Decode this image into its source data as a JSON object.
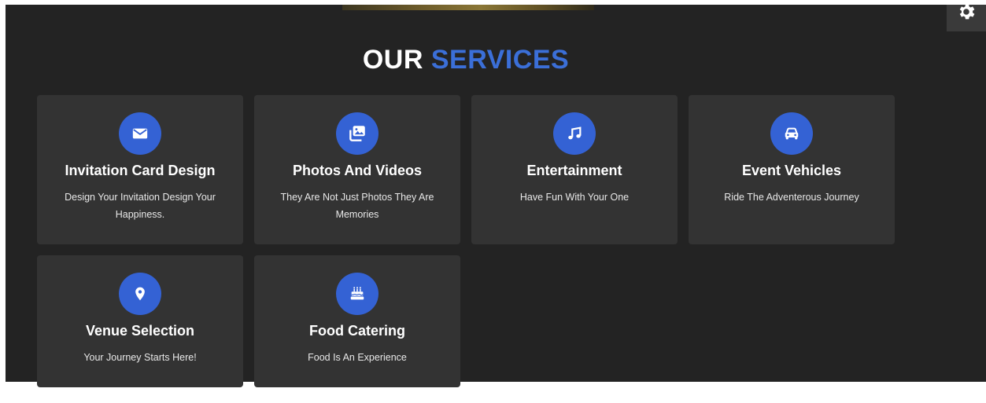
{
  "title": {
    "word1": "OUR",
    "word2": "SERVICES"
  },
  "colors": {
    "accent": "#3b6fd8",
    "icon_bg": "#3462d4",
    "card_bg": "#333333",
    "page_bg": "#232323"
  },
  "services": [
    {
      "icon": "envelope-icon",
      "title": "Invitation Card Design",
      "desc": "Design Your Invitation Design Your Happiness."
    },
    {
      "icon": "photo-gallery-icon",
      "title": "Photos And Videos",
      "desc": "They Are Not Just Photos They Are Memories"
    },
    {
      "icon": "music-note-icon",
      "title": "Entertainment",
      "desc": "Have Fun With Your One"
    },
    {
      "icon": "car-icon",
      "title": "Event Vehicles",
      "desc": "Ride The Adventerous Journey"
    },
    {
      "icon": "map-pin-icon",
      "title": "Venue Selection",
      "desc": "Your Journey Starts Here!"
    },
    {
      "icon": "birthday-cake-icon",
      "title": "Food Catering",
      "desc": "Food Is An Experience"
    }
  ],
  "settings_icon": "gear-icon"
}
